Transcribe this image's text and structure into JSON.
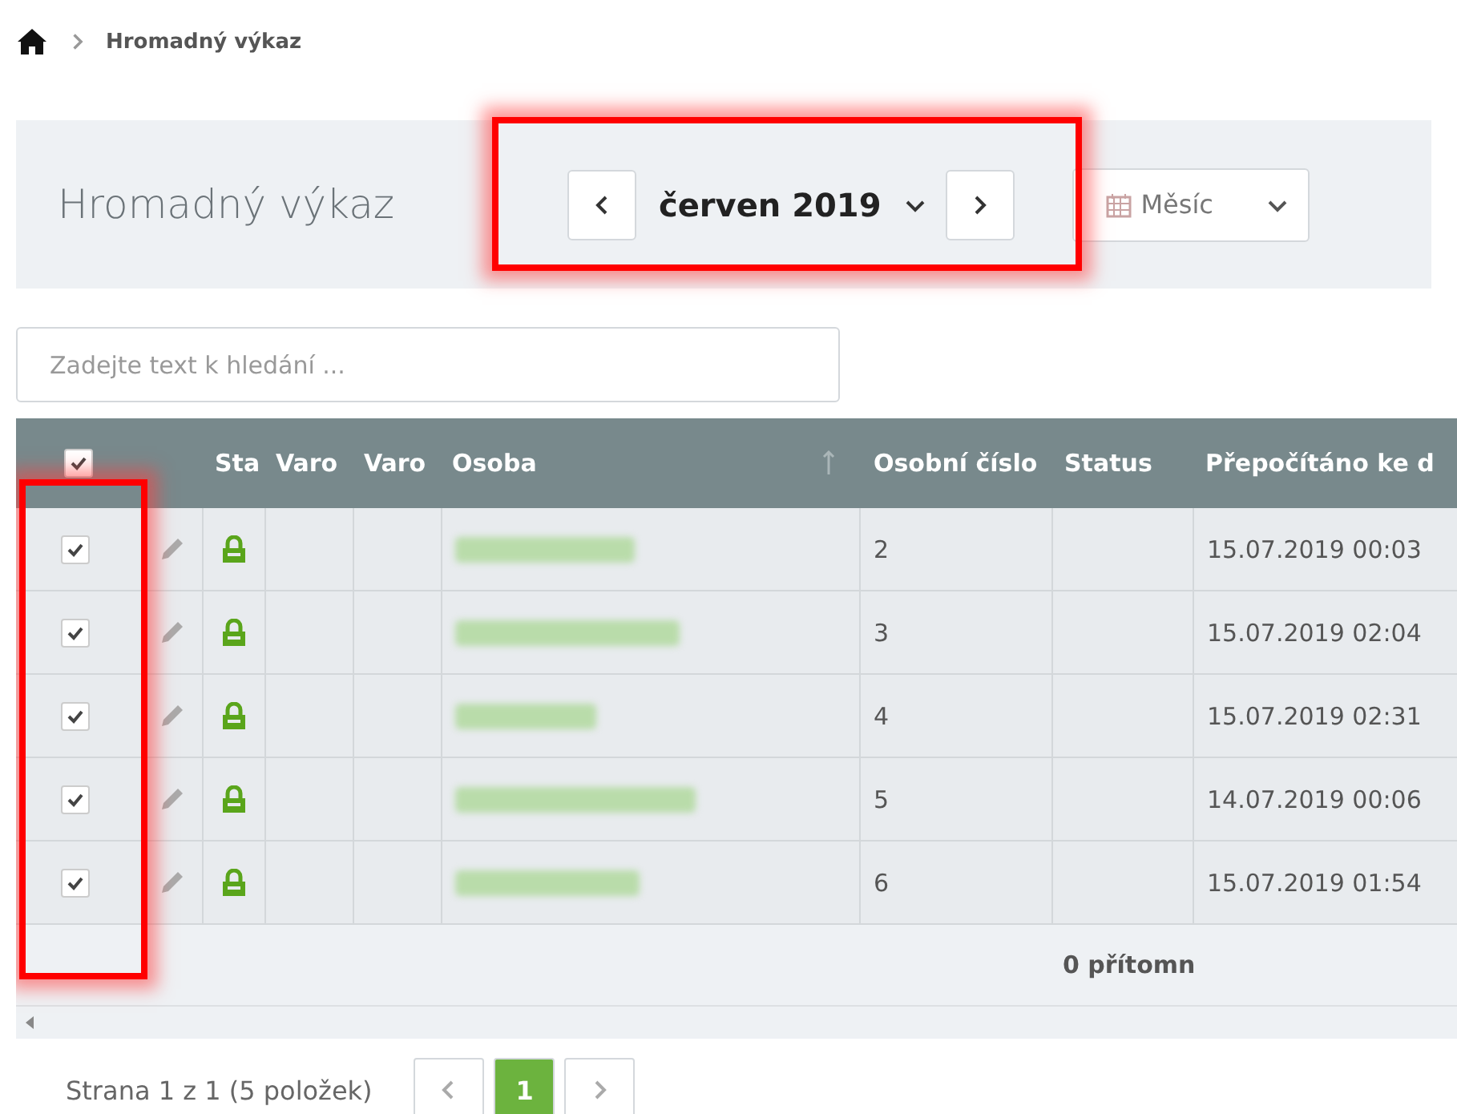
{
  "breadcrumb": {
    "current": "Hromadný výkaz"
  },
  "header": {
    "title": "Hromadný výkaz",
    "period": {
      "label": "červen 2019",
      "highlighted": true
    },
    "view_select": {
      "value": "Měsíc"
    }
  },
  "search": {
    "placeholder": "Zadejte text k hledání ..."
  },
  "table": {
    "select_all": {
      "checked": true
    },
    "checkbox_column_highlighted": true,
    "columns": [
      "Sta",
      "Varo",
      "Varo",
      "Osoba",
      "Osobní číslo",
      "Status",
      "Přepočítáno ke d"
    ],
    "rows": [
      {
        "checked": true,
        "locked": true,
        "number": "2",
        "recalculated": "15.07.2019 00:03"
      },
      {
        "checked": true,
        "locked": true,
        "number": "3",
        "recalculated": "15.07.2019 02:04"
      },
      {
        "checked": true,
        "locked": true,
        "number": "4",
        "recalculated": "15.07.2019 02:31"
      },
      {
        "checked": true,
        "locked": true,
        "number": "5",
        "recalculated": "14.07.2019 00:06"
      },
      {
        "checked": true,
        "locked": true,
        "number": "6",
        "recalculated": "15.07.2019 01:54"
      }
    ],
    "footer_status": "0 přítomn"
  },
  "pager": {
    "summary": "Strana 1 z 1 (5 položek)",
    "pages": [
      {
        "label": "1",
        "selected": true
      }
    ]
  }
}
